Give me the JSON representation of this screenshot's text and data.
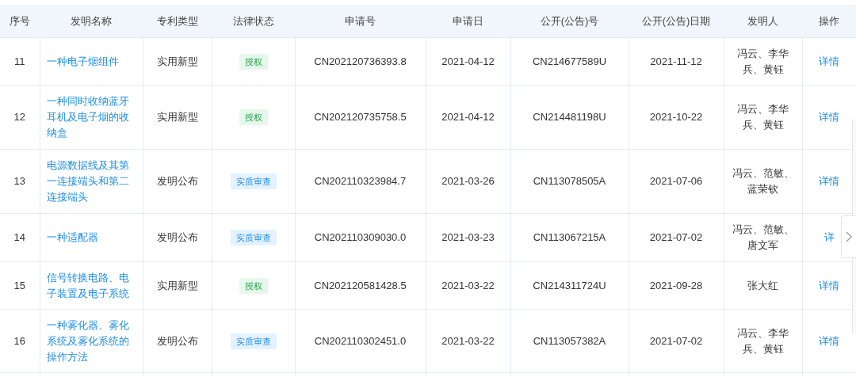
{
  "table": {
    "columns": [
      "序号",
      "发明名称",
      "专利类型",
      "法律状态",
      "申请号",
      "申请日",
      "公开(公告)号",
      "公开(公告)日期",
      "发明人",
      "操作"
    ],
    "rows": [
      {
        "index": "11",
        "name": "一种电子烟组件",
        "type": "实用新型",
        "status": {
          "label": "授权",
          "kind": "granted"
        },
        "app_no": "CN202120736393.8",
        "app_date": "2021-04-12",
        "pub_no": "CN214677589U",
        "pub_date": "2021-11-12",
        "inventors": "冯云、李华兵、黄钰",
        "action": "详情"
      },
      {
        "index": "12",
        "name": "一种同时收纳蓝牙耳机及电子烟的收纳盒",
        "type": "实用新型",
        "status": {
          "label": "授权",
          "kind": "granted"
        },
        "app_no": "CN202120735758.5",
        "app_date": "2021-04-12",
        "pub_no": "CN214481198U",
        "pub_date": "2021-10-22",
        "inventors": "冯云、李华兵、黄钰",
        "action": "详情"
      },
      {
        "index": "13",
        "name": "电源数据线及其第一连接端头和第二连接端头",
        "type": "发明公布",
        "status": {
          "label": "实质审查",
          "kind": "examination"
        },
        "app_no": "CN202110323984.7",
        "app_date": "2021-03-26",
        "pub_no": "CN113078505A",
        "pub_date": "2021-07-06",
        "inventors": "冯云、范敏、蓝荣钦",
        "action": "详情"
      },
      {
        "index": "14",
        "name": "一种适配器",
        "type": "发明公布",
        "status": {
          "label": "实质审查",
          "kind": "examination"
        },
        "app_no": "CN202110309030.0",
        "app_date": "2021-03-23",
        "pub_no": "CN113067215A",
        "pub_date": "2021-07-02",
        "inventors": "冯云、范敏、唐文军",
        "action": "详"
      },
      {
        "index": "15",
        "name": "信号转换电路、电子装置及电子系统",
        "type": "实用新型",
        "status": {
          "label": "授权",
          "kind": "granted"
        },
        "app_no": "CN202120581428.5",
        "app_date": "2021-03-22",
        "pub_no": "CN214311724U",
        "pub_date": "2021-09-28",
        "inventors": "张大红",
        "action": "详情"
      },
      {
        "index": "16",
        "name": "一种雾化器、雾化系统及雾化系统的操作方法",
        "type": "发明公布",
        "status": {
          "label": "实质审查",
          "kind": "examination"
        },
        "app_no": "CN202110302451.0",
        "app_date": "2021-03-22",
        "pub_no": "CN113057382A",
        "pub_date": "2021-07-02",
        "inventors": "冯云、李华兵、黄钰",
        "action": "详情"
      }
    ]
  }
}
